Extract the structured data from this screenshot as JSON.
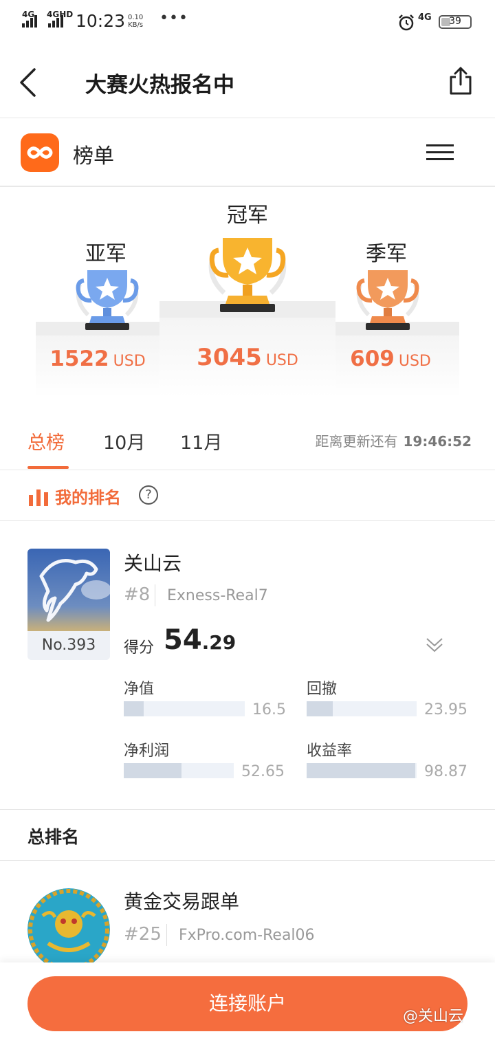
{
  "status_bar": {
    "net1": "4G",
    "net2": "4GHD",
    "time": "10:23",
    "speed_value": "0.10",
    "speed_unit": "KB/s",
    "more": "•••",
    "net3": "4G",
    "battery": "39",
    "battery_level_percent": 39
  },
  "nav": {
    "title": "大赛火热报名中",
    "back_icon": "chevron-left-icon",
    "share_icon": "share-icon"
  },
  "header": {
    "title": "榜单",
    "logo_icon": "app-logo-icon",
    "menu_icon": "hamburger-menu-icon"
  },
  "podium": {
    "champion": {
      "label": "冠军",
      "amount": "3045",
      "unit": "USD"
    },
    "runner_up": {
      "label": "亚军",
      "amount": "1522",
      "unit": "USD"
    },
    "third": {
      "label": "季军",
      "amount": "609",
      "unit": "USD"
    },
    "colors": {
      "gold": "#f5a623",
      "silver": "#6a9be8",
      "bronze": "#ef8a4c",
      "prize": "#f06f45"
    }
  },
  "tabs": {
    "items": [
      "总榜",
      "10月",
      "11月"
    ],
    "active": "总榜",
    "countdown_label": "距离更新还有",
    "countdown_time": "19:46:52"
  },
  "my_ranking": {
    "title": "我的排名",
    "help_icon": "question-circle-icon",
    "user": {
      "name": "关山云",
      "rank": "#8",
      "account": "Exness-Real7",
      "no": "No.393",
      "score_label": "得分",
      "score_int": "54",
      "score_dec": ".29"
    },
    "metrics": [
      {
        "label": "净值",
        "value": "16.5",
        "level": 0.165
      },
      {
        "label": "回撤",
        "value": "23.95",
        "level": 0.2395
      },
      {
        "label": "净利润",
        "value": "52.65",
        "level": 0.5265
      },
      {
        "label": "收益率",
        "value": "98.87",
        "level": 0.9887
      }
    ]
  },
  "total_ranking": {
    "title": "总排名",
    "rows": [
      {
        "name": "黄金交易跟单",
        "rank": "#25",
        "account": "FxPro.com-Real06"
      }
    ]
  },
  "bottom": {
    "connect_label": "连接账户",
    "watermark": "@关山云"
  },
  "accent_color": "#f26b3a"
}
